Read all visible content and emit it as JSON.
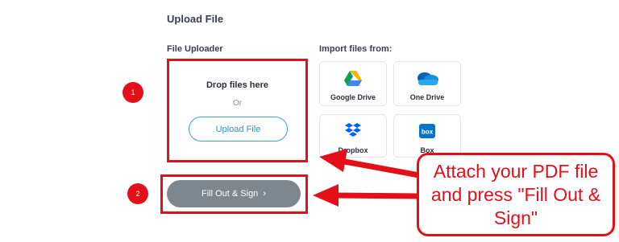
{
  "page": {
    "heading": "Upload File",
    "uploader_label": "File Uploader",
    "import_label": "Import files from:"
  },
  "dropzone": {
    "title": "Drop files here",
    "or_text": "Or",
    "upload_button": "Upload File"
  },
  "providers": [
    {
      "name": "Google Drive",
      "icon": "google-drive-icon"
    },
    {
      "name": "One Drive",
      "icon": "onedrive-icon"
    },
    {
      "name": "Dropbox",
      "icon": "dropbox-icon"
    },
    {
      "name": "Box",
      "icon": "box-icon"
    }
  ],
  "fill_button": {
    "label": "Fill Out & Sign",
    "chevron": "›"
  },
  "annotations": {
    "step1": "1",
    "step2": "2",
    "callout": "Attach your PDF file and press \"Fill Out & Sign\"",
    "highlight_color": "#e3101a"
  },
  "colors": {
    "accent_blue": "#2891d6",
    "button_gray": "#7d8790"
  }
}
